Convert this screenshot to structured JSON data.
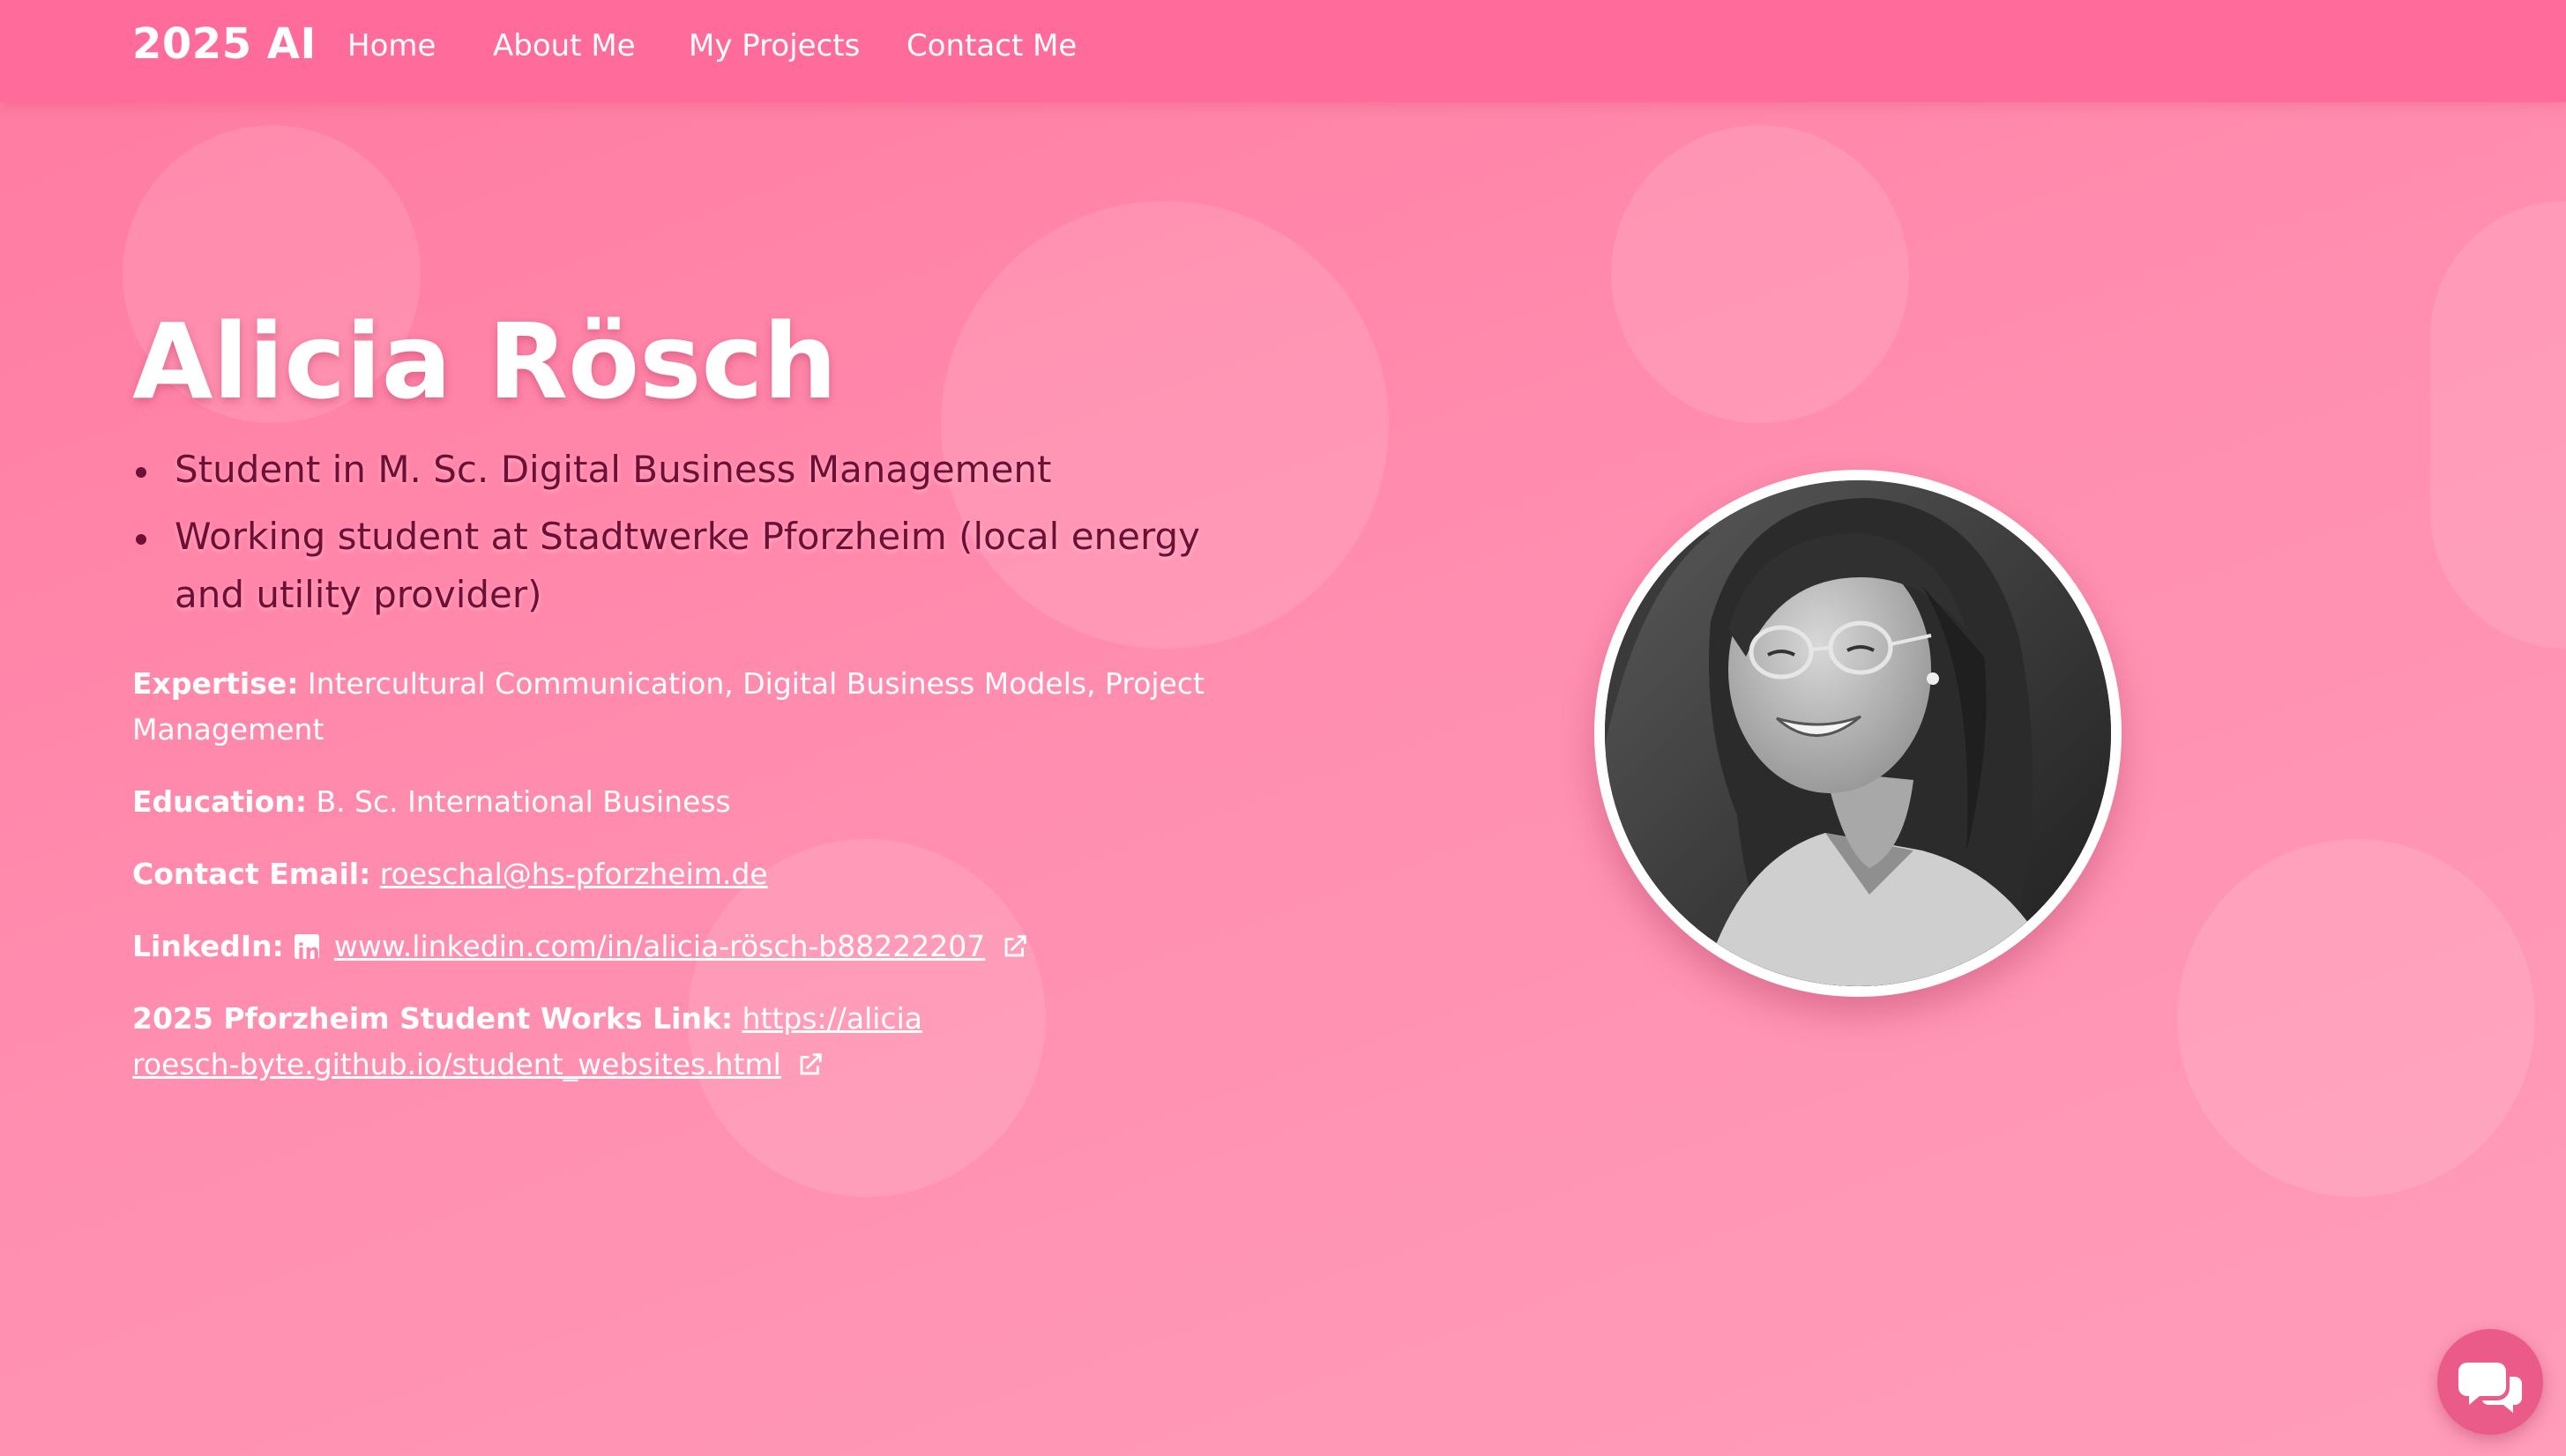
{
  "nav": {
    "brand": "2025 AI",
    "links": [
      "Home",
      "About Me",
      "My Projects",
      "Contact Me"
    ]
  },
  "hero": {
    "name": "Alicia Rösch",
    "roles": [
      "Student in M. Sc. Digital Business Management",
      "Working student at Stadtwerke Pforzheim (local energy and utility provider)"
    ],
    "expertise": {
      "label": "Expertise:",
      "value": "Intercultural Communication, Digital Business Models, Project Management"
    },
    "education": {
      "label": "Education:",
      "value": "B. Sc. International Business"
    },
    "contact_email": {
      "label": "Contact Email:",
      "value": "roeschal@hs-pforzheim.de"
    },
    "linkedin": {
      "label": "LinkedIn:",
      "logo_text": "in",
      "value": "www.linkedin.com/in/alicia-rösch-b88222207"
    },
    "student_works": {
      "label": "2025 Pforzheim Student Works Link:",
      "value": "https://aliciaroesch-byte.github.io/student_websites.html"
    }
  },
  "photo": {
    "icon": "profile-photo"
  },
  "chat": {
    "icon": "chat-bubbles-icon"
  },
  "colors": {
    "nav_bg": "#ff6b9a",
    "page_gradient_start": "#ff7aa0",
    "page_gradient_end": "#ff9dba",
    "role_text": "#6e0f35",
    "chat_button": "#ea5b8a"
  }
}
